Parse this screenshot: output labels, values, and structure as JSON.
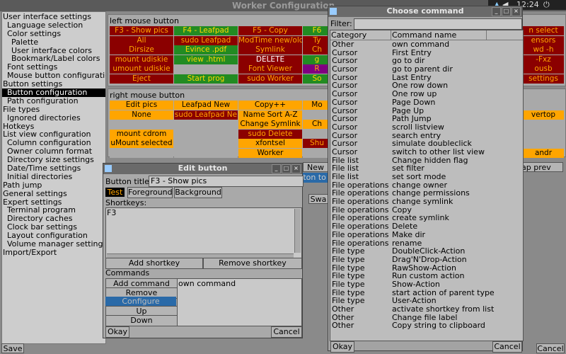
{
  "main_title": "Worker Configuration",
  "clock": "12:24",
  "tree": [
    "User interface settings",
    "  Language selection",
    "  Color settings",
    "    Palette",
    "    User interface colors",
    "    Bookmark/Label colors",
    "  Font settings",
    "  Mouse button configuration",
    "Button settings",
    "  Button configuration",
    "  Path configuration",
    "File types",
    "  Ignored directories",
    "Hotkeys",
    "List view configuration",
    "  Column configuration",
    "  Owner column format",
    "  Directory size settings",
    "  Date/Time settings",
    "  Initial directories",
    "Path jump",
    "General settings",
    "Expert settings",
    "  Terminal program",
    "  Directory caches",
    "  Clock bar settings",
    "  Layout configuration",
    "  Volume manager settings",
    "Import/Export"
  ],
  "save_label": "Save",
  "cancel_label": "Cancel",
  "left_mouse_label": "left mouse button",
  "right_mouse_label": "right mouse button",
  "left_grid": [
    [
      {
        "t": "F3 - Show pics",
        "bg": "#8b0000",
        "fg": "#ffa500"
      },
      {
        "t": "F4 - Leafpad",
        "bg": "#228b22",
        "fg": "#ffd700"
      },
      {
        "t": "F5 - Copy",
        "bg": "#8b0000",
        "fg": "#ffa500"
      },
      {
        "t": "F6",
        "bg": "#228b22",
        "fg": "#ffd700"
      }
    ],
    [
      {
        "t": "All",
        "bg": "#8b0000",
        "fg": "#ffa500"
      },
      {
        "t": "sudo Leafpad",
        "bg": "#8b0000",
        "fg": "#ffa500"
      },
      {
        "t": "ModTime new/old",
        "bg": "#8b0000",
        "fg": "#ffa500"
      },
      {
        "t": "Ty",
        "bg": "#8b0000",
        "fg": "#ffa500"
      }
    ],
    [
      {
        "t": "Dirsize",
        "bg": "#8b0000",
        "fg": "#ffa500"
      },
      {
        "t": "Evince .pdf",
        "bg": "#228b22",
        "fg": "#ffd700"
      },
      {
        "t": "Symlink",
        "bg": "#8b0000",
        "fg": "#ffa500"
      },
      {
        "t": "Ch",
        "bg": "#8b0000",
        "fg": "#ffa500"
      }
    ],
    [
      {
        "t": "mount udiskie",
        "bg": "#8b0000",
        "fg": "#ffa500"
      },
      {
        "t": "view .html",
        "bg": "#228b22",
        "fg": "#ffd700"
      },
      {
        "t": "DELETE",
        "bg": "#8b0000",
        "fg": "#ffffff"
      },
      {
        "t": "g",
        "bg": "#228b22",
        "fg": "#ffd700"
      }
    ],
    [
      {
        "t": "umount udiskie",
        "bg": "#8b0000",
        "fg": "#ffa500"
      },
      {
        "t": "",
        "bg": "#a9a9a9",
        "fg": "#000"
      },
      {
        "t": "Font Viewer",
        "bg": "#8b0000",
        "fg": "#ffa500"
      },
      {
        "t": "R",
        "bg": "#800080",
        "fg": "#ffa500"
      }
    ],
    [
      {
        "t": "Eject",
        "bg": "#8b0000",
        "fg": "#ffa500"
      },
      {
        "t": "Start prog",
        "bg": "#228b22",
        "fg": "#ffd700"
      },
      {
        "t": "sudo Worker",
        "bg": "#8b0000",
        "fg": "#ffa500"
      },
      {
        "t": "So",
        "bg": "#228b22",
        "fg": "#ffd700"
      }
    ]
  ],
  "right_grid": [
    [
      {
        "t": "Edit pics",
        "bg": "#ffa500",
        "fg": "#000"
      },
      {
        "t": "Leafpad New",
        "bg": "#ffa500",
        "fg": "#000"
      },
      {
        "t": "Copy++",
        "bg": "#ffa500",
        "fg": "#000"
      },
      {
        "t": "Mo",
        "bg": "#ffa500",
        "fg": "#000"
      }
    ],
    [
      {
        "t": "None",
        "bg": "#ffa500",
        "fg": "#000"
      },
      {
        "t": "sudo Leafpad Ne",
        "bg": "#8b0000",
        "fg": "#ffa500"
      },
      {
        "t": "Name Sort A-Z",
        "bg": "#ffa500",
        "fg": "#000"
      },
      {
        "t": "",
        "bg": "#a9a9a9",
        "fg": "#000"
      }
    ],
    [
      {
        "t": "",
        "bg": "#a9a9a9",
        "fg": "#000"
      },
      {
        "t": "",
        "bg": "#a9a9a9",
        "fg": "#000"
      },
      {
        "t": "Change Symlink",
        "bg": "#ffa500",
        "fg": "#000"
      },
      {
        "t": "Ch",
        "bg": "#ffa500",
        "fg": "#000"
      }
    ],
    [
      {
        "t": "mount cdrom",
        "bg": "#ffa500",
        "fg": "#000"
      },
      {
        "t": "",
        "bg": "#a9a9a9",
        "fg": "#000"
      },
      {
        "t": "sudo Delete",
        "bg": "#8b0000",
        "fg": "#ffa500"
      },
      {
        "t": "",
        "bg": "#a9a9a9",
        "fg": "#000"
      }
    ],
    [
      {
        "t": "uMount selected",
        "bg": "#ffa500",
        "fg": "#000"
      },
      {
        "t": "",
        "bg": "#a9a9a9",
        "fg": "#000"
      },
      {
        "t": "xfontsel",
        "bg": "#ffa500",
        "fg": "#000"
      },
      {
        "t": "Shu",
        "bg": "#8b0000",
        "fg": "#ffa500"
      }
    ],
    [
      {
        "t": "",
        "bg": "#a9a9a9",
        "fg": "#000"
      },
      {
        "t": "",
        "bg": "#a9a9a9",
        "fg": "#000"
      },
      {
        "t": "Worker",
        "bg": "#ffa500",
        "fg": "#000"
      },
      {
        "t": "",
        "bg": "#a9a9a9",
        "fg": "#000"
      }
    ]
  ],
  "right_edge_left": [
    {
      "t": "n select",
      "bg": "#8b0000",
      "fg": "#ffa500"
    },
    {
      "t": "ensors",
      "bg": "#8b0000",
      "fg": "#ffa500"
    },
    {
      "t": "wd -h",
      "bg": "#8b0000",
      "fg": "#ffa500"
    },
    {
      "t": "-Fxz",
      "bg": "#8b0000",
      "fg": "#ffa500"
    },
    {
      "t": "ousb",
      "bg": "#8b0000",
      "fg": "#ffa500"
    },
    {
      "t": "settings",
      "bg": "#8b0000",
      "fg": "#ffa500"
    }
  ],
  "right_edge_right": [
    {
      "t": "",
      "bg": "#a9a9a9",
      "fg": "#000"
    },
    {
      "t": "vertop",
      "bg": "#ffa500",
      "fg": "#000"
    },
    {
      "t": "",
      "bg": "#a9a9a9",
      "fg": "#000"
    },
    {
      "t": "",
      "bg": "#a9a9a9",
      "fg": "#000"
    },
    {
      "t": "",
      "bg": "#a9a9a9",
      "fg": "#000"
    },
    {
      "t": "andr",
      "bg": "#ffa500",
      "fg": "#000"
    }
  ],
  "behind": {
    "new": "New",
    "selected": "tton to",
    "swap": "Swa",
    "swap_prev": "ap prev"
  },
  "edit": {
    "title": "Edit button",
    "button_title_label": "Button title:",
    "button_title_value": "F3 - Show pics",
    "test_label": "Test",
    "foreground_label": "Foreground",
    "background_label": "Background",
    "shortkeys_label": "Shortkeys:",
    "shortkey_value": "F3",
    "add_shortkey": "Add shortkey",
    "remove_shortkey": "Remove shortkey",
    "commands_label": "Commands",
    "add_command": "Add command",
    "remove_command": "Remove command",
    "configure": "Configure",
    "up": "Up",
    "down": "Down",
    "command_item": "own command",
    "okay": "Okay",
    "cancel": "Cancel"
  },
  "choose": {
    "title": "Choose command",
    "filter_label": "Filter:",
    "col_category": "Category",
    "col_command": "Command name",
    "okay": "Okay",
    "cancel": "Cancel",
    "rows": [
      [
        "Other",
        "own command"
      ],
      [
        "Cursor",
        "First Entry"
      ],
      [
        "Cursor",
        "go to dir"
      ],
      [
        "Cursor",
        "go to parent dir"
      ],
      [
        "Cursor",
        "Last Entry"
      ],
      [
        "Cursor",
        "One row down"
      ],
      [
        "Cursor",
        "One row up"
      ],
      [
        "Cursor",
        "Page Down"
      ],
      [
        "Cursor",
        "Page Up"
      ],
      [
        "Cursor",
        "Path Jump"
      ],
      [
        "Cursor",
        "scroll listview"
      ],
      [
        "Cursor",
        "search entry"
      ],
      [
        "Cursor",
        "simulate doubleclick"
      ],
      [
        "Cursor",
        "switch to other list view"
      ],
      [
        "File list",
        "Change hidden flag"
      ],
      [
        "File list",
        "set filter"
      ],
      [
        "File list",
        "set sort mode"
      ],
      [
        "File operations",
        "change owner"
      ],
      [
        "File operations",
        "change permissions"
      ],
      [
        "File operations",
        "change symlink"
      ],
      [
        "File operations",
        "Copy"
      ],
      [
        "File operations",
        "create symlink"
      ],
      [
        "File operations",
        "Delete"
      ],
      [
        "File operations",
        "Make dir"
      ],
      [
        "File operations",
        "rename"
      ],
      [
        "File type",
        "DoubleClick-Action"
      ],
      [
        "File type",
        "Drag'N'Drop-Action"
      ],
      [
        "File type",
        "RawShow-Action"
      ],
      [
        "File type",
        "Run custom action"
      ],
      [
        "File type",
        "Show-Action"
      ],
      [
        "File type",
        "start action of parent type"
      ],
      [
        "File type",
        "User-Action"
      ],
      [
        "Other",
        "activate shortkey from list"
      ],
      [
        "Other",
        "Change file label"
      ],
      [
        "Other",
        "Copy string to clipboard"
      ]
    ]
  }
}
